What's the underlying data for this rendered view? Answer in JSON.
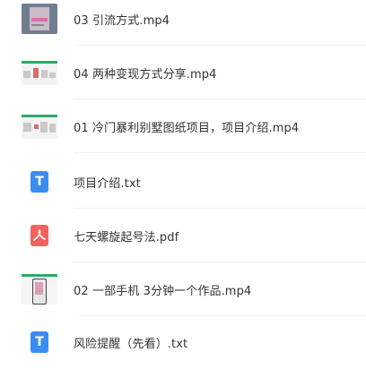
{
  "files": [
    {
      "name": "03 引流方式.mp4",
      "type": "video",
      "icon": "video-thumbnail-icon"
    },
    {
      "name": "04 两种变现方式分享.mp4",
      "type": "video",
      "icon": "video-thumbnail-icon"
    },
    {
      "name": "01 冷门暴利别墅图纸项目，项目介绍.mp4",
      "type": "video",
      "icon": "video-thumbnail-icon"
    },
    {
      "name": "项目介绍.txt",
      "type": "txt",
      "icon": "text-file-icon",
      "glyph": "T"
    },
    {
      "name": "七天螺旋起号法.pdf",
      "type": "pdf",
      "icon": "pdf-file-icon"
    },
    {
      "name": "02 一部手机 3分钟一个作品.mp4",
      "type": "video",
      "icon": "video-thumbnail-icon"
    },
    {
      "name": "风险提醒（先看）.txt",
      "type": "txt",
      "icon": "text-file-icon",
      "glyph": "T"
    }
  ],
  "colors": {
    "txt_icon": "#3a8cf0",
    "pdf_icon": "#f2635e",
    "thumb_accent": "#2fa868",
    "text": "#333333"
  }
}
